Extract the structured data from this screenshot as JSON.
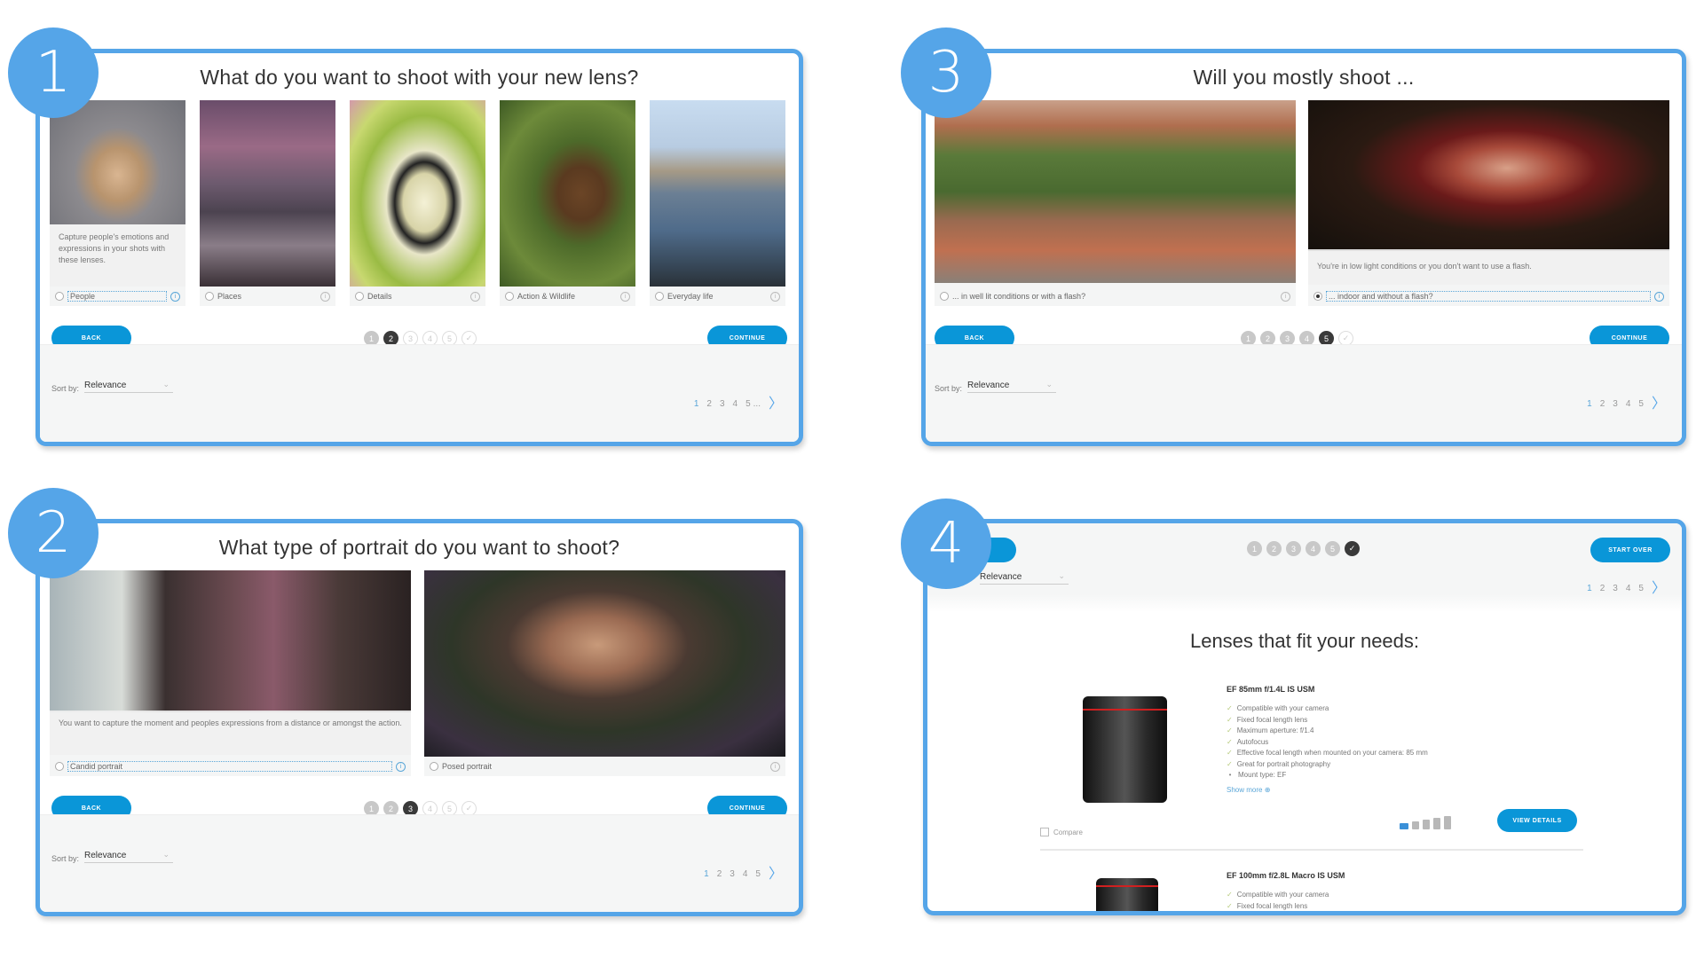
{
  "badges": [
    "1",
    "2",
    "3",
    "4"
  ],
  "common": {
    "back_label": "BACK",
    "continue_label": "CONTINUE",
    "sort_label": "Sort by:",
    "sort_value": "Relevance",
    "pages": [
      "1",
      "2",
      "3",
      "4",
      "5"
    ],
    "ellipsis": "...",
    "next_icon": "chevron-right-icon",
    "info_icon": "info-icon",
    "colors": {
      "accent": "#0a96d8",
      "frame": "#55a5e8",
      "active_step": "#3a3a3a",
      "done_step": "#c8c8c8"
    }
  },
  "panel1": {
    "title": "What do you want to shoot with your new lens?",
    "steps": [
      {
        "label": "1",
        "state": "done"
      },
      {
        "label": "2",
        "state": "active"
      },
      {
        "label": "3",
        "state": "todo"
      },
      {
        "label": "4",
        "state": "todo"
      },
      {
        "label": "5",
        "state": "todo"
      },
      {
        "label": "✓",
        "state": "todo"
      }
    ],
    "options": [
      {
        "label": "People",
        "selected": false,
        "focused": true,
        "description": "Capture people's emotions and expressions in your shots with these lenses.",
        "image": "woman-fur-hood"
      },
      {
        "label": "Places",
        "selected": false,
        "focused": false,
        "image": "rocky-seascape-dusk"
      },
      {
        "label": "Details",
        "selected": false,
        "focused": false,
        "image": "butterfly-macro"
      },
      {
        "label": "Action & Wildlife",
        "selected": false,
        "focused": false,
        "image": "bird-of-prey-flying"
      },
      {
        "label": "Everyday life",
        "selected": false,
        "focused": false,
        "image": "city-waterfront"
      }
    ]
  },
  "panel2": {
    "title": "What type of portrait do you want to shoot?",
    "steps": [
      {
        "label": "1",
        "state": "done"
      },
      {
        "label": "2",
        "state": "done"
      },
      {
        "label": "3",
        "state": "active"
      },
      {
        "label": "4",
        "state": "todo"
      },
      {
        "label": "5",
        "state": "todo"
      },
      {
        "label": "✓",
        "state": "todo"
      }
    ],
    "options": [
      {
        "label": "Candid portrait",
        "selected": false,
        "focused": true,
        "description": "You want to capture the moment and peoples expressions from a distance or amongst the action.",
        "image": "woman-in-van"
      },
      {
        "label": "Posed portrait",
        "selected": false,
        "focused": false,
        "image": "older-man-scarf"
      }
    ]
  },
  "panel3": {
    "title": "Will you mostly shoot ...",
    "steps": [
      {
        "label": "1",
        "state": "done"
      },
      {
        "label": "2",
        "state": "done"
      },
      {
        "label": "3",
        "state": "done"
      },
      {
        "label": "4",
        "state": "done"
      },
      {
        "label": "5",
        "state": "active"
      },
      {
        "label": "✓",
        "state": "todo"
      }
    ],
    "options": [
      {
        "label": "... in well lit conditions or with a flash?",
        "selected": false,
        "focused": false,
        "image": "woman-rooftop-town"
      },
      {
        "label": "... indoor and without a flash?",
        "selected": true,
        "focused": true,
        "description": "You're in low light conditions or you don't want to use a flash.",
        "image": "woman-candlelight"
      }
    ]
  },
  "panel4": {
    "start_over_label": "START OVER",
    "steps": [
      {
        "label": "1",
        "state": "done"
      },
      {
        "label": "2",
        "state": "done"
      },
      {
        "label": "3",
        "state": "done"
      },
      {
        "label": "4",
        "state": "done"
      },
      {
        "label": "5",
        "state": "done"
      },
      {
        "label": "✓",
        "state": "active"
      }
    ],
    "result_title": "Lenses that fit your needs:",
    "lenses": [
      {
        "name": "EF 85mm f/1.4L IS USM",
        "features": [
          {
            "text": "Compatible with your camera",
            "mark": "check"
          },
          {
            "text": "Fixed focal length lens",
            "mark": "check"
          },
          {
            "text": "Maximum aperture: f/1.4",
            "mark": "check"
          },
          {
            "text": "Autofocus",
            "mark": "check"
          },
          {
            "text": "Effective focal length when mounted on your camera: 85 mm",
            "mark": "check"
          },
          {
            "text": "Great for portrait photography",
            "mark": "check"
          },
          {
            "text": "Mount type: EF",
            "mark": "bullet"
          }
        ],
        "show_more": "Show more",
        "compare_label": "Compare",
        "view_details_label": "VIEW DETAILS"
      },
      {
        "name": "EF 100mm f/2.8L Macro IS USM",
        "features": [
          {
            "text": "Compatible with your camera",
            "mark": "check"
          },
          {
            "text": "Fixed focal length lens",
            "mark": "check"
          }
        ]
      }
    ]
  }
}
